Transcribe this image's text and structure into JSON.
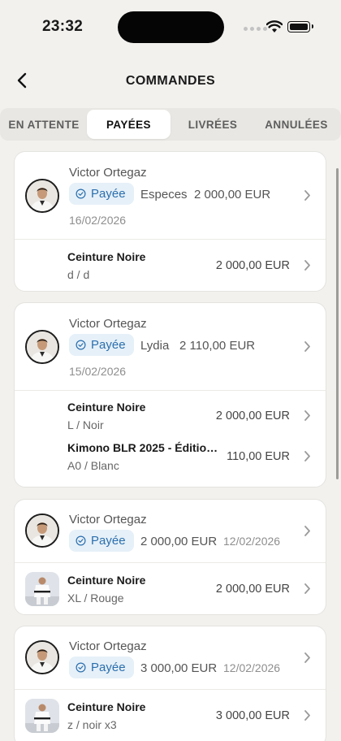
{
  "status_bar": {
    "time": "23:32"
  },
  "header": {
    "title": "COMMANDES",
    "back_icon": "chevron-left-icon"
  },
  "tabs": [
    {
      "label": "EN ATTENTE",
      "active": false
    },
    {
      "label": "PAYÉES",
      "active": true
    },
    {
      "label": "LIVRÉES",
      "active": false
    },
    {
      "label": "ANNULÉES",
      "active": false
    }
  ],
  "orders": [
    {
      "customer": "Victor Ortegaz",
      "status": "Payée",
      "payment_method": "Especes",
      "total": "2 000,00 EUR",
      "date": "16/02/2026",
      "items": [
        {
          "name": "Ceinture Noire",
          "variant": "d / d",
          "price": "2 000,00 EUR",
          "has_thumb": false
        }
      ]
    },
    {
      "customer": "Victor Ortegaz",
      "status": "Payée",
      "payment_method": "Lydia",
      "total": "2 110,00 EUR",
      "date": "15/02/2026",
      "items": [
        {
          "name": "Ceinture Noire",
          "variant": "L / Noir",
          "price": "2 000,00 EUR",
          "has_thumb": false
        },
        {
          "name": "Kimono BLR 2025 - Édition...",
          "variant": "A0 / Blanc",
          "price": "110,00 EUR",
          "has_thumb": false
        }
      ]
    },
    {
      "customer": "Victor Ortegaz",
      "status": "Payée",
      "total": "2 000,00 EUR",
      "date": "12/02/2026",
      "items": [
        {
          "name": "Ceinture Noire",
          "variant": "XL / Rouge",
          "price": "2 000,00 EUR",
          "has_thumb": true
        }
      ]
    },
    {
      "customer": "Victor Ortegaz",
      "status": "Payée",
      "total": "3 000,00 EUR",
      "date": "12/02/2026",
      "items": [
        {
          "name": "Ceinture Noire",
          "variant": "z / noir x3",
          "price": "3 000,00 EUR",
          "has_thumb": true
        }
      ]
    }
  ],
  "colors": {
    "background": "#f2f1ee",
    "badge_bg": "#e6f0f8",
    "badge_text": "#2b6fae",
    "card": "#ffffff"
  }
}
